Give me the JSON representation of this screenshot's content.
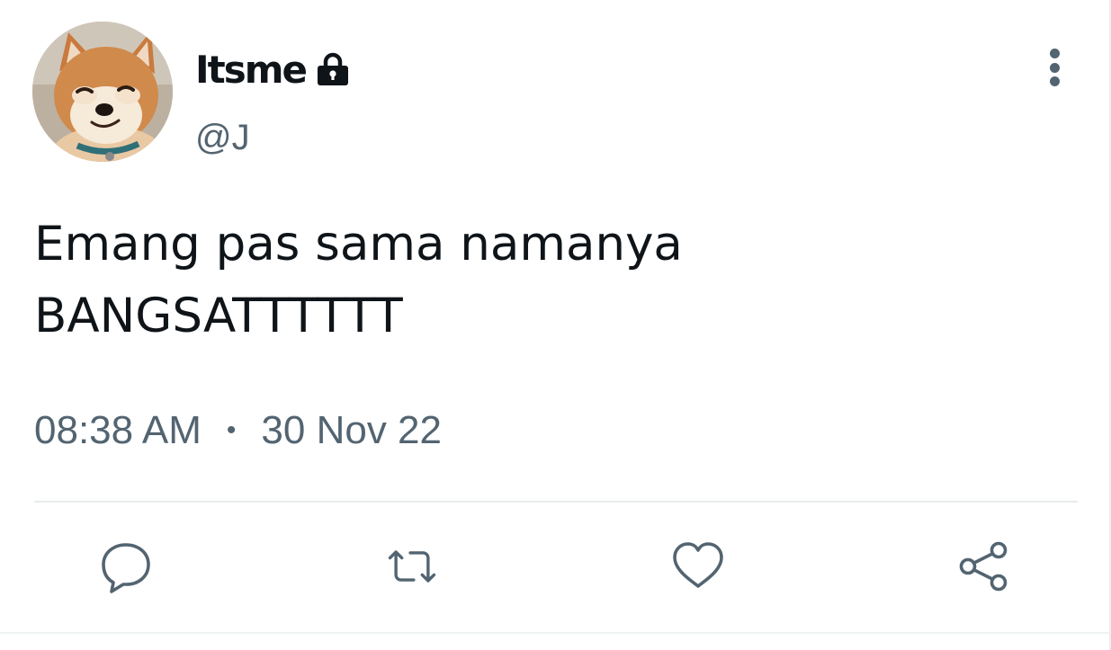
{
  "user": {
    "display_name": "Itsme",
    "handle": "@J",
    "avatar_icon": "shiba-dog-avatar",
    "locked_icon": "lock-icon"
  },
  "tweet": {
    "text_lines": [
      "Emang pas sama namanya",
      "BANGSATTTTTT"
    ],
    "time": "08:38 AM",
    "separator": "•",
    "date": "30 Nov 22"
  },
  "actions": {
    "reply_icon": "reply-icon",
    "retweet_icon": "retweet-icon",
    "like_icon": "heart-icon",
    "share_icon": "share-icon",
    "more_icon": "more-vertical-icon"
  },
  "colors": {
    "text_primary": "#0f1419",
    "text_secondary": "#536471",
    "divider": "#e8ebed"
  }
}
